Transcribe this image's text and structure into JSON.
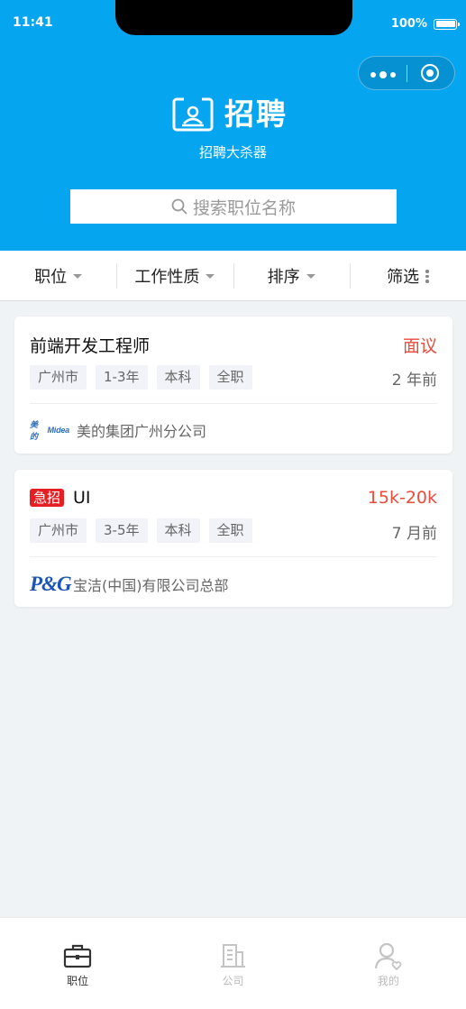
{
  "status_bar": {
    "time": "11:41",
    "battery": "100%"
  },
  "header": {
    "title": "招聘",
    "slogan": "招聘大杀器",
    "search_placeholder": "搜索职位名称"
  },
  "filters": [
    {
      "label": "职位",
      "icon": "caret-down-icon"
    },
    {
      "label": "工作性质",
      "icon": "caret-down-icon"
    },
    {
      "label": "排序",
      "icon": "caret-down-icon"
    },
    {
      "label": "筛选",
      "icon": "vertical-dots-icon"
    }
  ],
  "jobs": [
    {
      "title": "前端开发工程师",
      "urgent": "",
      "salary": "面议",
      "tags": [
        "广州市",
        "1-3年",
        "本科",
        "全职"
      ],
      "posted": "2 年前",
      "company": "美的集团广州分公司",
      "company_logo": "Midea",
      "company_logo_prefix": "美的"
    },
    {
      "title": "UI",
      "urgent": "急招",
      "salary": "15k-20k",
      "tags": [
        "广州市",
        "3-5年",
        "本科",
        "全职"
      ],
      "posted": "7 月前",
      "company": "宝洁(中国)有限公司总部",
      "company_logo": "P&G"
    }
  ],
  "tabbar": [
    {
      "label": "职位",
      "icon": "briefcase-icon",
      "active": true
    },
    {
      "label": "公司",
      "icon": "building-icon",
      "active": false
    },
    {
      "label": "我的",
      "icon": "user-icon",
      "active": false
    }
  ],
  "colors": {
    "primary": "#06a5f0",
    "salary": "#e94c3d",
    "urgent": "#e51f24"
  }
}
